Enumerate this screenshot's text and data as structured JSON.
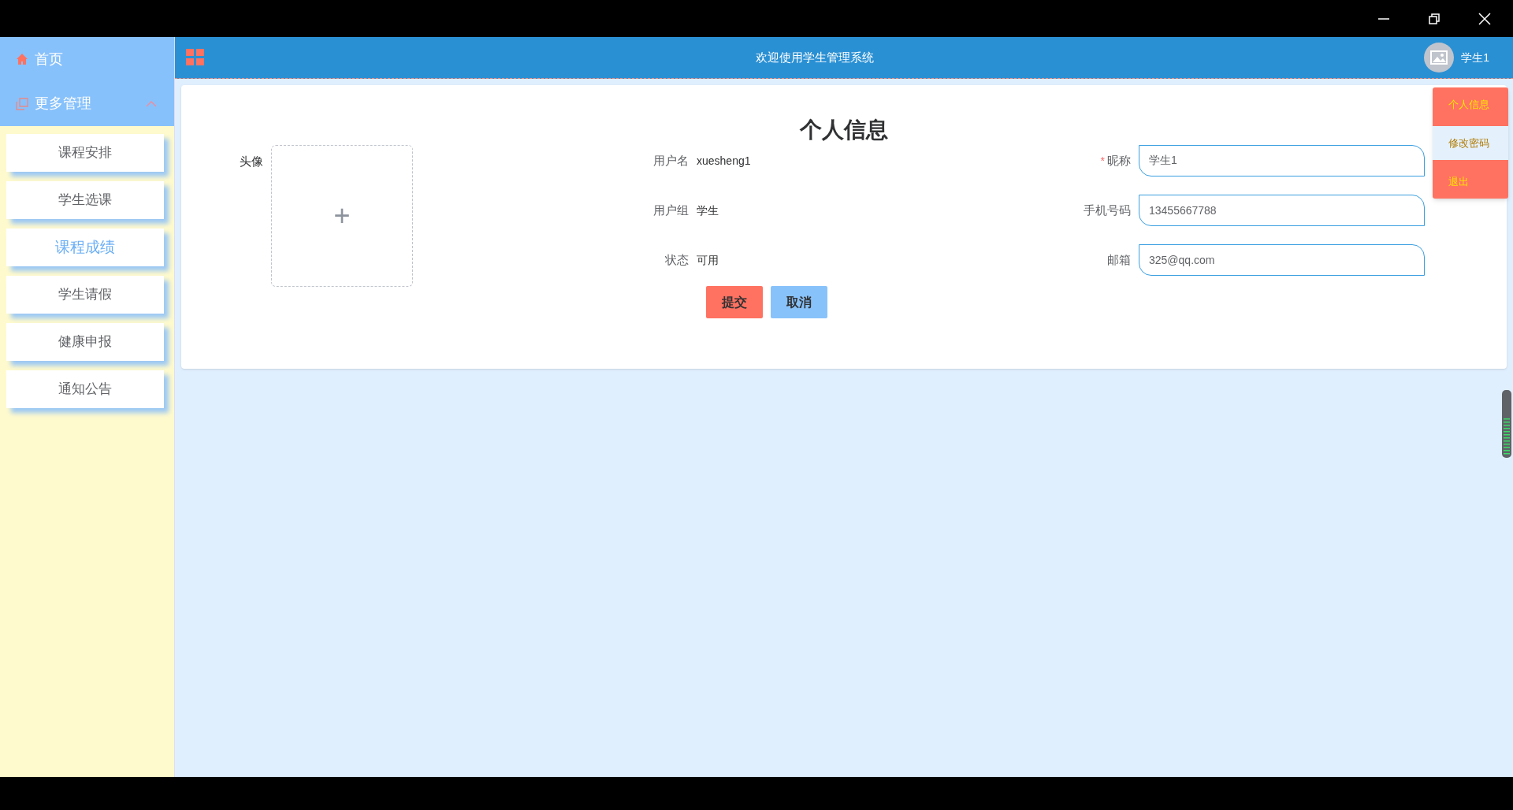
{
  "sidebar": {
    "home": {
      "label": "首页"
    },
    "group": {
      "label": "更多管理",
      "expanded": true,
      "items": [
        {
          "label": "课程安排",
          "selected": false
        },
        {
          "label": "学生选课",
          "selected": false
        },
        {
          "label": "课程成绩",
          "selected": true
        },
        {
          "label": "学生请假",
          "selected": false
        },
        {
          "label": "健康申报",
          "selected": false
        },
        {
          "label": "通知公告",
          "selected": false
        }
      ]
    }
  },
  "header": {
    "title": "欢迎使用学生管理系统",
    "user": "学生1"
  },
  "user_menu": [
    {
      "label": "个人信息",
      "selected": false
    },
    {
      "label": "修改密码",
      "selected": true
    },
    {
      "label": "退出",
      "selected": false
    }
  ],
  "form": {
    "title": "个人信息",
    "avatar_label": "头像",
    "upload_icon": "+",
    "info": [
      {
        "label": "用户名",
        "value": "xuesheng1"
      },
      {
        "label": "用户组",
        "value": "学生"
      },
      {
        "label": "状态",
        "value": "可用"
      }
    ],
    "fields": [
      {
        "label": "昵称",
        "required": true,
        "value": "学生1"
      },
      {
        "label": "手机号码",
        "required": false,
        "value": "13455667788"
      },
      {
        "label": "邮箱",
        "required": false,
        "value": "325@qq.com"
      }
    ],
    "required_mark": "*",
    "buttons": [
      {
        "label": "提交",
        "kind": "primary"
      },
      {
        "label": "取消",
        "kind": "secondary"
      }
    ]
  }
}
